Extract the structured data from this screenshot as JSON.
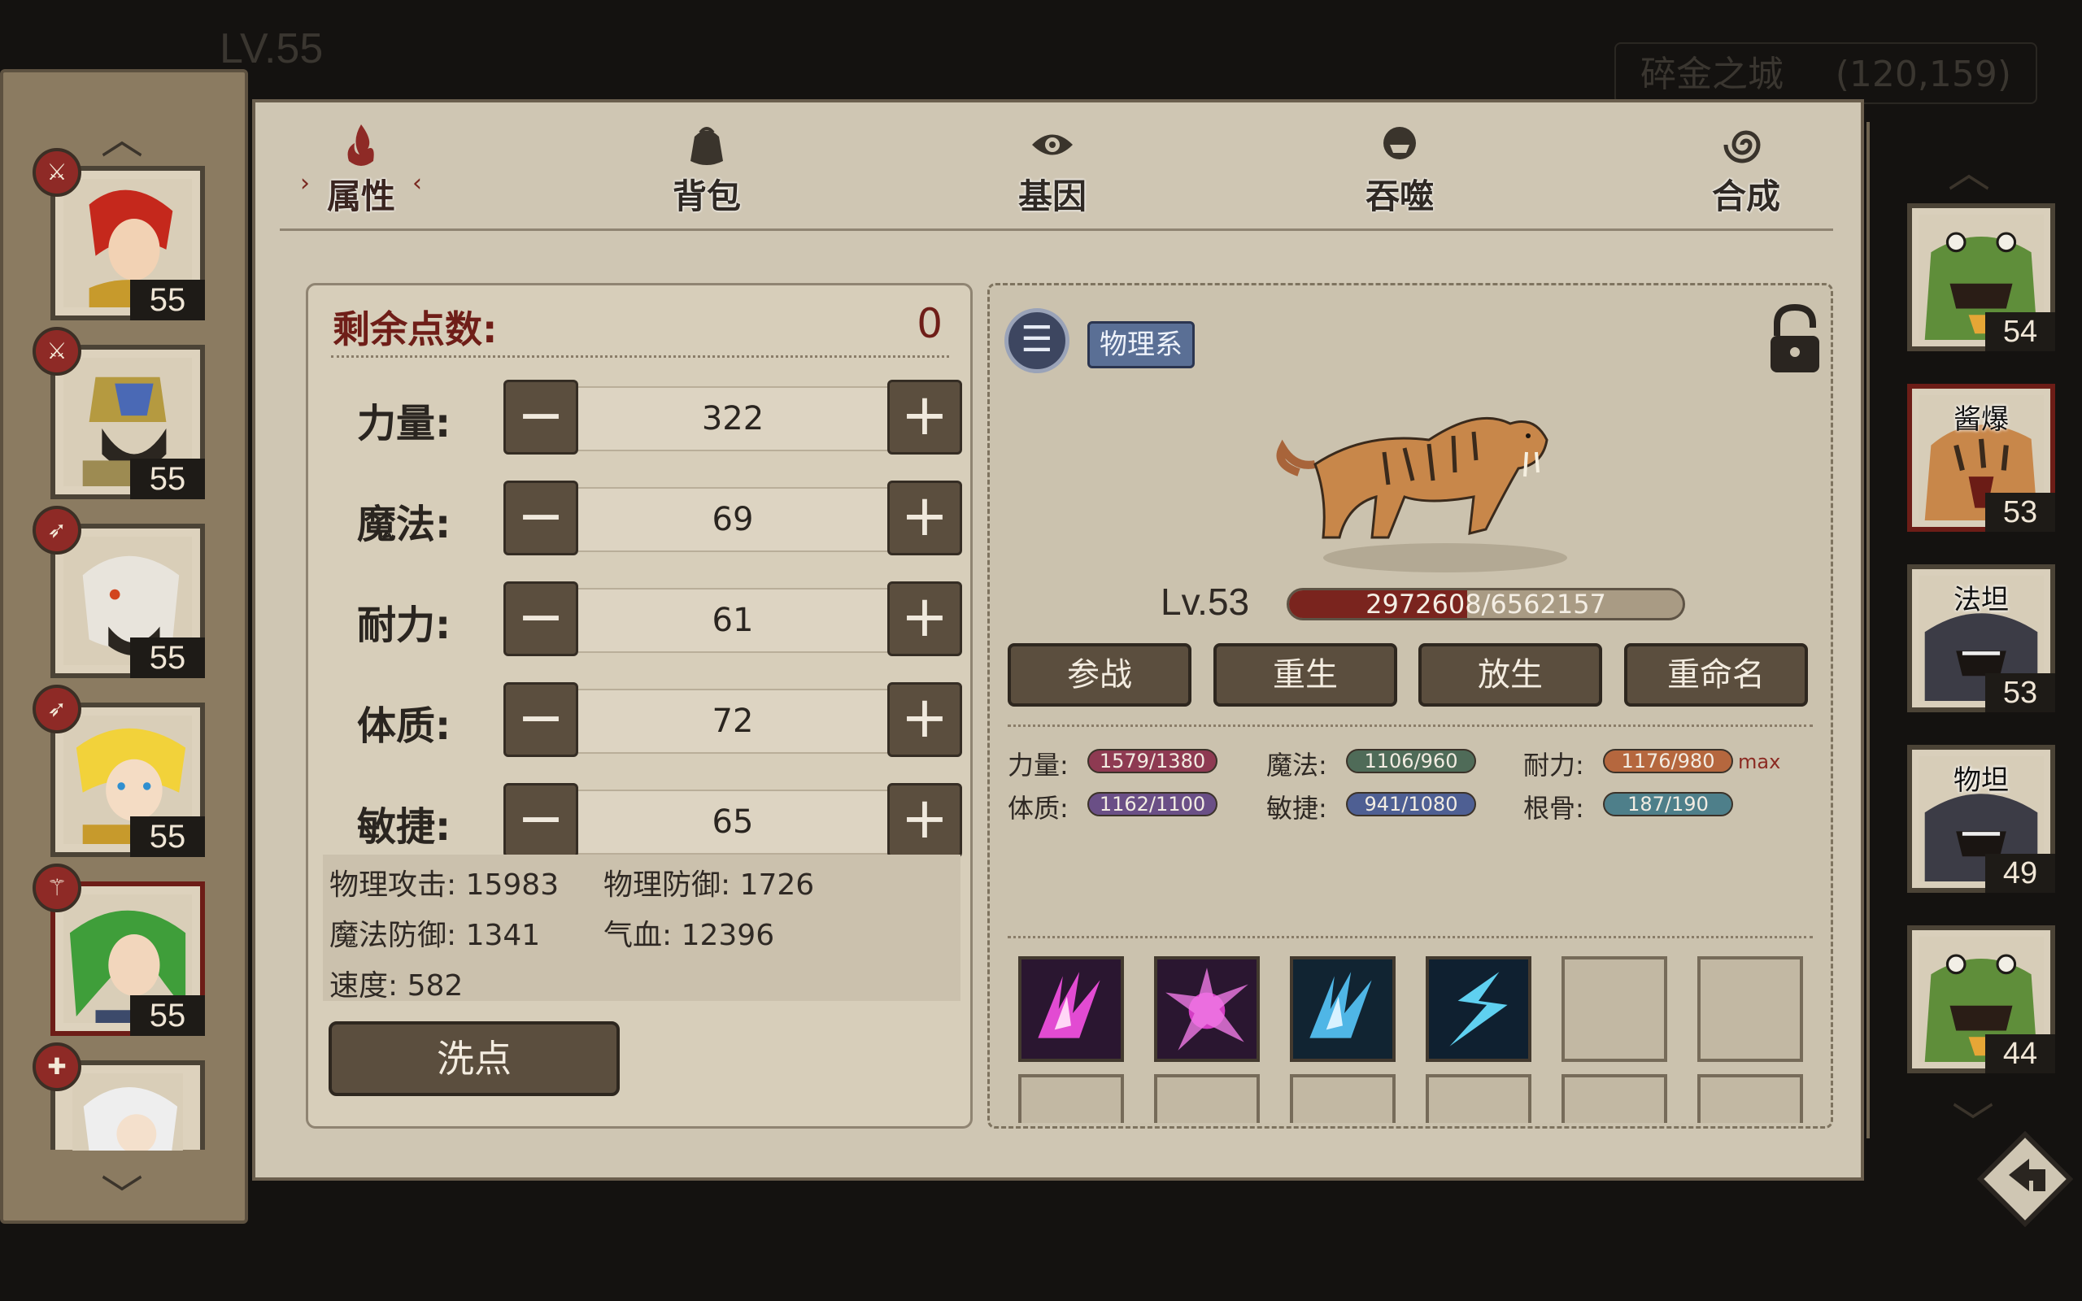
{
  "hud": {
    "level": "LV.55",
    "location": "碎金之城",
    "coords": "(120,159)"
  },
  "tabs": [
    {
      "label": "属性",
      "icon": "flame-icon",
      "active": true
    },
    {
      "label": "背包",
      "icon": "bag-icon",
      "active": false
    },
    {
      "label": "基因",
      "icon": "eye-icon",
      "active": false
    },
    {
      "label": "吞噬",
      "icon": "devour-icon",
      "active": false
    },
    {
      "label": "合成",
      "icon": "spiral-icon",
      "active": false
    }
  ],
  "left_roster": [
    {
      "level": "55",
      "badge": "sword"
    },
    {
      "level": "55",
      "badge": "sword"
    },
    {
      "level": "55",
      "badge": "bow"
    },
    {
      "level": "55",
      "badge": "bow"
    },
    {
      "level": "55",
      "badge": "staff",
      "selected": true
    },
    {
      "level": "",
      "badge": "cross"
    }
  ],
  "attributes": {
    "points_label": "剩余点数:",
    "points_value": "0",
    "stats": [
      {
        "label": "力量:",
        "value": "322"
      },
      {
        "label": "魔法:",
        "value": "69"
      },
      {
        "label": "耐力:",
        "value": "61"
      },
      {
        "label": "体质:",
        "value": "72"
      },
      {
        "label": "敏捷:",
        "value": "65"
      }
    ],
    "derived": {
      "phys_atk": "物理攻击: 15983",
      "phys_def": "物理防御: 1726",
      "mag_def": "魔法防御: 1341",
      "hp": "气血: 12396",
      "speed": "速度: 582"
    },
    "reset_label": "洗点"
  },
  "pet": {
    "type": "物理系",
    "level": "Lv.53",
    "exp_text": "2972608/6562157",
    "exp_fraction": 0.453,
    "actions": [
      "参战",
      "重生",
      "放生",
      "重命名"
    ],
    "growth": [
      {
        "label": "力量:",
        "value": "1579/1380",
        "color": "#8e3a52",
        "max": ""
      },
      {
        "label": "魔法:",
        "value": "1106/960",
        "color": "#4f6b58",
        "max": ""
      },
      {
        "label": "耐力:",
        "value": "1176/980",
        "color": "#b5673e",
        "max": "max"
      },
      {
        "label": "体质:",
        "value": "1162/1100",
        "color": "#6a4f86",
        "max": ""
      },
      {
        "label": "敏捷:",
        "value": "941/1080",
        "color": "#4e5f93",
        "max": ""
      },
      {
        "label": "根骨:",
        "value": "187/190",
        "color": "#4e7f8a",
        "max": ""
      }
    ],
    "skills": [
      "claw-magenta-icon",
      "burst-magenta-icon",
      "claw-cyan-icon",
      "lightning-cyan-icon"
    ]
  },
  "right_roster": [
    {
      "tag": "",
      "level": "54"
    },
    {
      "tag": "酱爆",
      "level": "53",
      "selected": true
    },
    {
      "tag": "法坦",
      "level": "53"
    },
    {
      "tag": "物坦",
      "level": "49"
    },
    {
      "tag": "",
      "level": "44"
    }
  ]
}
